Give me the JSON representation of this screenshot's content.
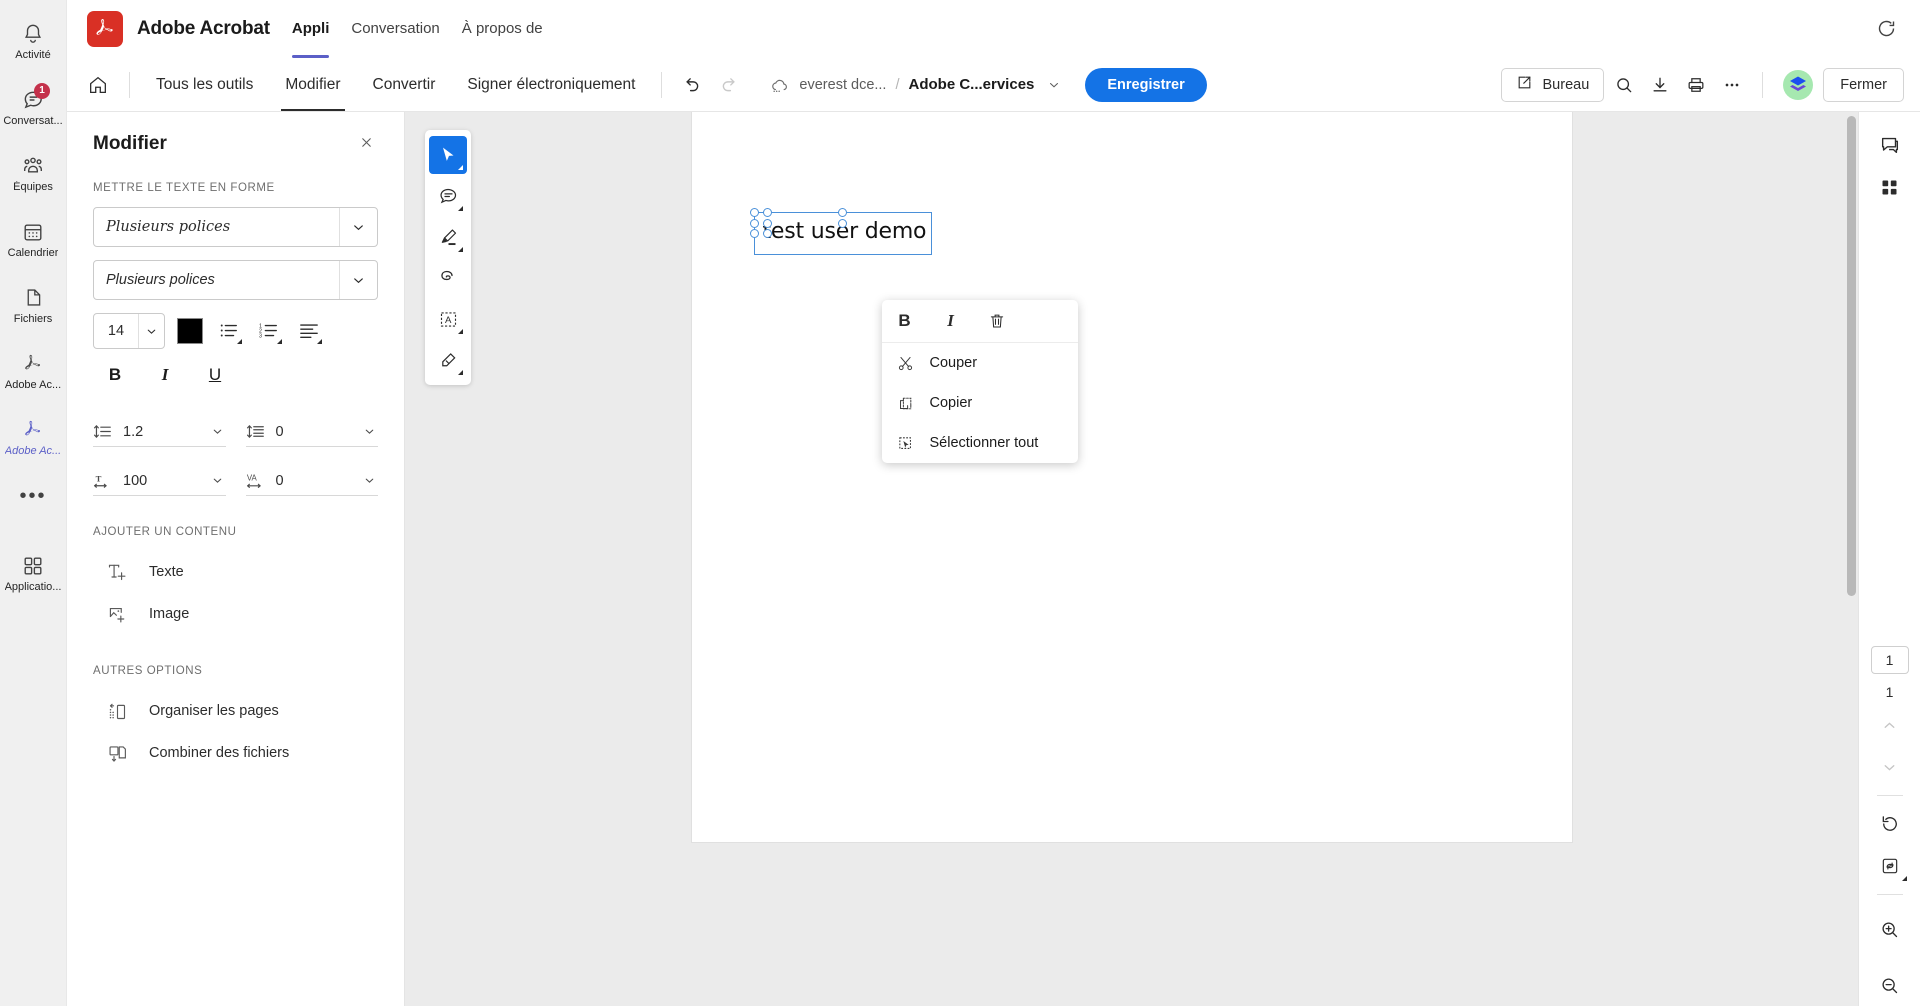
{
  "rail": {
    "items": [
      {
        "label": "Activité",
        "icon": "bell-icon",
        "badge": null,
        "active": false
      },
      {
        "label": "Conversat...",
        "icon": "chat-icon",
        "badge": "1",
        "active": false
      },
      {
        "label": "Équipes",
        "icon": "teams-icon",
        "badge": null,
        "active": false
      },
      {
        "label": "Calendrier",
        "icon": "calendar-icon",
        "badge": null,
        "active": false
      },
      {
        "label": "Fichiers",
        "icon": "file-icon",
        "badge": null,
        "active": false
      },
      {
        "label": "Adobe Ac...",
        "icon": "adobe-acrobat-icon",
        "badge": null,
        "active": false
      },
      {
        "label": "Adobe Ac...",
        "icon": "adobe-acrobat-icon",
        "badge": null,
        "active": true
      }
    ],
    "more_label": "•••",
    "apps": {
      "label": "Applicatio...",
      "icon": "apps-grid-icon"
    }
  },
  "appbar": {
    "logo": "adobe-acrobat-logo",
    "title": "Adobe Acrobat",
    "tabs": [
      {
        "label": "Appli",
        "selected": true
      },
      {
        "label": "Conversation",
        "selected": false
      },
      {
        "label": "À propos de",
        "selected": false
      }
    ],
    "refresh_icon": "refresh-icon"
  },
  "toolbar": {
    "home_icon": "home-icon",
    "menus": [
      {
        "label": "Tous les outils",
        "selected": false
      },
      {
        "label": "Modifier",
        "selected": true
      },
      {
        "label": "Convertir",
        "selected": false
      },
      {
        "label": "Signer électroniquement",
        "selected": false
      }
    ],
    "undo_icon": "undo-icon",
    "redo_icon": "redo-icon",
    "breadcrumb": {
      "cloud_icon": "cloud-icon",
      "parent": "everest dce...",
      "separator": "/",
      "current": "Adobe C...ervices",
      "chevron": "chevron-down-icon"
    },
    "save_label": "Enregistrer",
    "desktop_label": "Bureau",
    "desktop_icon": "open-external-icon",
    "search_icon": "search-icon",
    "download_icon": "download-icon",
    "print_icon": "print-icon",
    "more_icon": "more-horizontal-icon",
    "avatar": "user-avatar",
    "close_label": "Fermer",
    "accent_color": "#1473e6"
  },
  "panel": {
    "title": "Modifier",
    "close_icon": "close-icon",
    "format_section_label": "METTRE LE TEXTE EN FORME",
    "font_family": "Plusieurs polices",
    "font_style": "Plusieurs polices",
    "font_size": "14",
    "color_swatch": "#000000",
    "bullet_list_icon": "bullet-list-icon",
    "numbered_list_icon": "numbered-list-icon",
    "align_icon": "align-left-icon",
    "bold_label": "B",
    "italic_label": "I",
    "underline_label": "U",
    "line_spacing": {
      "icon": "line-spacing-icon",
      "value": "1.2"
    },
    "paragraph_spacing": {
      "icon": "paragraph-spacing-icon",
      "value": "0"
    },
    "horizontal_scale": {
      "icon": "horizontal-scale-icon",
      "value": "100"
    },
    "tracking": {
      "icon": "tracking-icon",
      "value": "0"
    },
    "add_section_label": "AJOUTER UN CONTENU",
    "add_items": [
      {
        "label": "Texte",
        "icon": "add-text-icon"
      },
      {
        "label": "Image",
        "icon": "add-image-icon"
      }
    ],
    "other_section_label": "AUTRES OPTIONS",
    "other_items": [
      {
        "label": "Organiser les pages",
        "icon": "organize-pages-icon"
      },
      {
        "label": "Combiner des fichiers",
        "icon": "combine-files-icon"
      }
    ]
  },
  "quick_tools": [
    {
      "name": "select-tool",
      "active": true
    },
    {
      "name": "comment-tool",
      "active": false
    },
    {
      "name": "highlight-tool",
      "active": false
    },
    {
      "name": "draw-tool",
      "active": false
    },
    {
      "name": "edit-text-tool",
      "active": false
    },
    {
      "name": "signature-tool",
      "active": false
    }
  ],
  "document": {
    "selected_text": "test user demo",
    "page_number": "1",
    "page_total": "1"
  },
  "context_menu": {
    "bold_label": "B",
    "italic_label": "I",
    "delete_icon": "trash-icon",
    "items": [
      {
        "label": "Couper",
        "icon": "cut-icon"
      },
      {
        "label": "Copier",
        "icon": "copy-icon"
      },
      {
        "label": "Sélectionner tout",
        "icon": "select-all-icon"
      }
    ]
  },
  "right_rail": {
    "top": [
      {
        "name": "comments-icon"
      },
      {
        "name": "thumbnails-icon"
      }
    ],
    "page_number": "1",
    "page_total": "1",
    "prev_icon": "chevron-up-icon",
    "next_icon": "chevron-down-icon",
    "rotate_icon": "rotate-icon",
    "fit_page_icon": "fit-page-icon",
    "zoom_in_icon": "zoom-in-icon",
    "zoom_out_icon": "zoom-out-icon"
  }
}
